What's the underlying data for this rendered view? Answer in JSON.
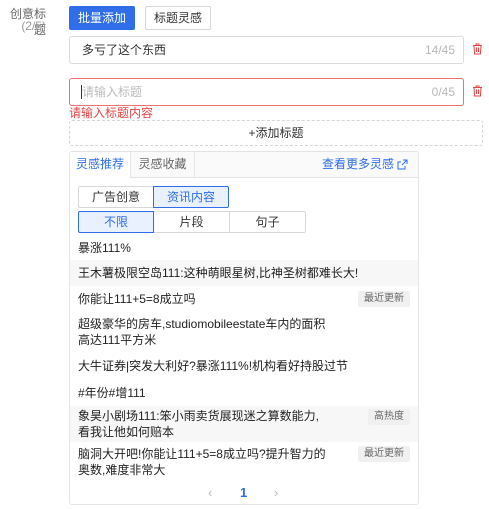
{
  "field": {
    "label": "创意标题",
    "count": "(2/5)"
  },
  "toolbar": {
    "batch_add": "批量添加",
    "title_inspiration": "标题灵感"
  },
  "titles": [
    {
      "value": "多亏了这个东西",
      "counter": "14/45"
    },
    {
      "value": "",
      "placeholder": "请输入标题",
      "counter": "0/45"
    }
  ],
  "error_message": "请输入标题内容",
  "add_title_label": "+添加标题",
  "panel": {
    "tabs": [
      "灵感推荐",
      "灵感收藏"
    ],
    "more_link": "查看更多灵感",
    "source_filters": [
      "广告创意",
      "资讯内容"
    ],
    "length_filters": [
      "不限",
      "片段",
      "句子"
    ],
    "items": [
      {
        "text": "暴涨111%",
        "badge": ""
      },
      {
        "text": "王木薯极限空岛111:这种萌眼星树,比神圣树都难长大!",
        "badge": ""
      },
      {
        "text": "你能让111+5=8成立吗",
        "badge": "最近更新"
      },
      {
        "text": "超级豪华的房车,studiomobileestate车内的面积高达111平方米",
        "badge": ""
      },
      {
        "text": "大牛证券|突发大利好?暴涨111%!机构看好持股过节",
        "badge": ""
      },
      {
        "text": "#年份#增111",
        "badge": ""
      },
      {
        "text": "象昊小剧场111:笨小雨卖货展现迷之算数能力,看我让他如何赔本",
        "badge": "高热度"
      },
      {
        "text": "脑洞大开吧!你能让111+5=8成立吗?提升智力的奥数,难度非常大",
        "badge": "最近更新"
      }
    ],
    "pagination": {
      "prev": "‹",
      "current": "1",
      "next": "›"
    }
  },
  "colors": {
    "primary": "#2f6ee8",
    "error": "#e64545",
    "trash": "#e64545"
  }
}
